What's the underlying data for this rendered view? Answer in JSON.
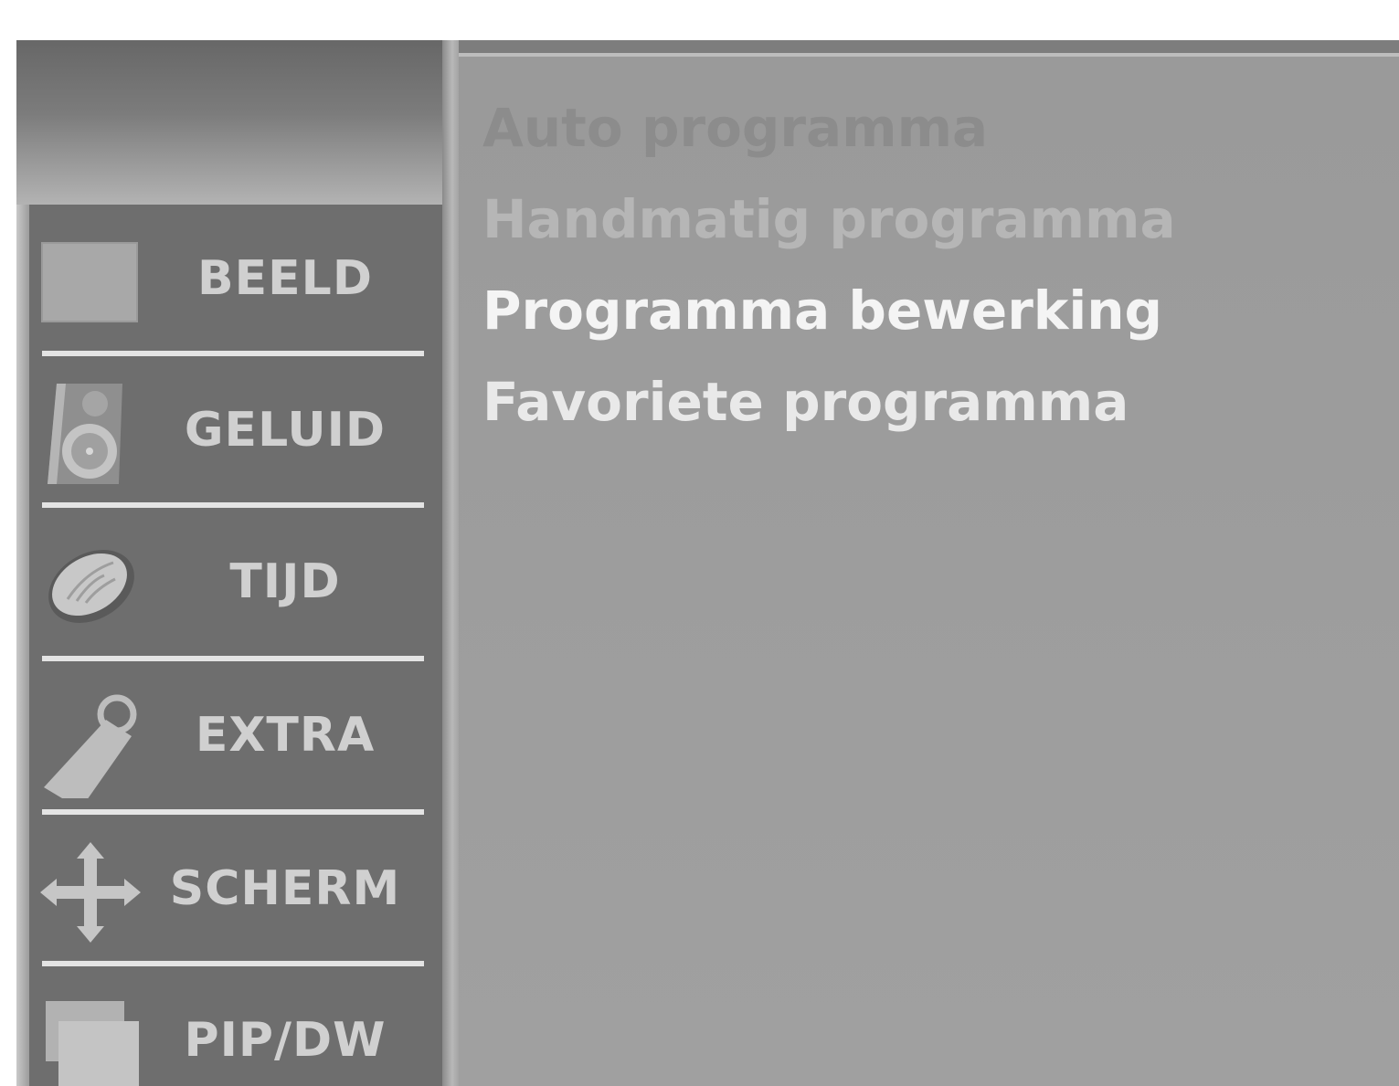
{
  "sidebar": {
    "items": [
      {
        "label": "BEELD",
        "icon": "picture-square-icon"
      },
      {
        "label": "GELUID",
        "icon": "speaker-icon"
      },
      {
        "label": "TIJD",
        "icon": "clock-icon"
      },
      {
        "label": "EXTRA",
        "icon": "tag-icon"
      },
      {
        "label": "SCHERM",
        "icon": "move-arrows-icon"
      },
      {
        "label": "PIP/DW",
        "icon": "pip-windows-icon"
      }
    ]
  },
  "submenu": {
    "items": [
      {
        "label": "Auto programma",
        "state": "disabled",
        "color": "#8c8c8c"
      },
      {
        "label": "Handmatig programma",
        "state": "faded",
        "color": "#b6b6b6"
      },
      {
        "label": "Programma bewerking",
        "state": "highlighted",
        "color": "#f4f4f4"
      },
      {
        "label": "Favoriete programma",
        "state": "normal",
        "color": "#e9e9e9"
      }
    ]
  },
  "colors": {
    "sidebar_bg": "#6e6e6e",
    "content_bg": "#9e9e9e",
    "sidebar_text": "#d0d0d0",
    "divider": "#e4e4e4"
  }
}
